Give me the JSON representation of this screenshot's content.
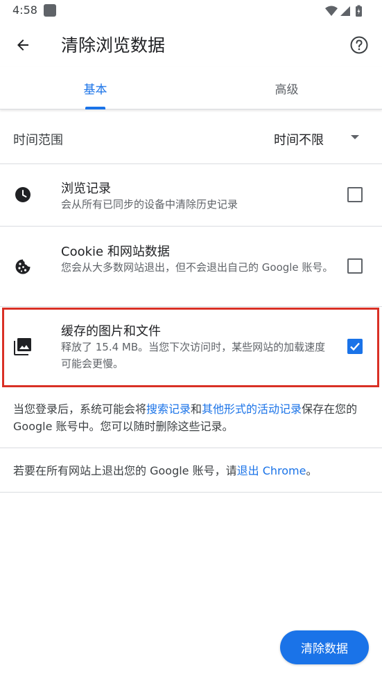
{
  "status_bar": {
    "time": "4:58"
  },
  "toolbar": {
    "title": "清除浏览数据"
  },
  "tabs": [
    {
      "label": "基本",
      "selected": true
    },
    {
      "label": "高级",
      "selected": false
    }
  ],
  "time_range": {
    "label": "时间范围",
    "value": "时间不限"
  },
  "options": [
    {
      "icon": "clock-icon",
      "title": "浏览记录",
      "subtitle": "会从所有已同步的设备中清除历史记录",
      "checked": false
    },
    {
      "icon": "cookie-icon",
      "title": "Cookie 和网站数据",
      "subtitle": "您会从大多数网站退出，但不会退出自己的 Google 账号。",
      "checked": false
    },
    {
      "icon": "image-stack-icon",
      "title": "缓存的图片和文件",
      "subtitle": "释放了 15.4 MB。当您下次访问时，某些网站的加载速度可能会更慢。",
      "checked": true
    }
  ],
  "info": {
    "p1_before": "当您登录后，系统可能会将",
    "p1_link1": "搜索记录",
    "p1_mid": "和",
    "p1_link2": "其他形式的活动记录",
    "p1_after": "保存在您的 Google 账号中。您可以随时删除这些记录。",
    "p2_before": "若要在所有网站上退出您的 Google 账号，请",
    "p2_link": "退出 Chrome",
    "p2_after": "。"
  },
  "clear_button": {
    "label": "清除数据"
  },
  "colors": {
    "accent": "#1a73e8",
    "highlight": "#d93025"
  }
}
